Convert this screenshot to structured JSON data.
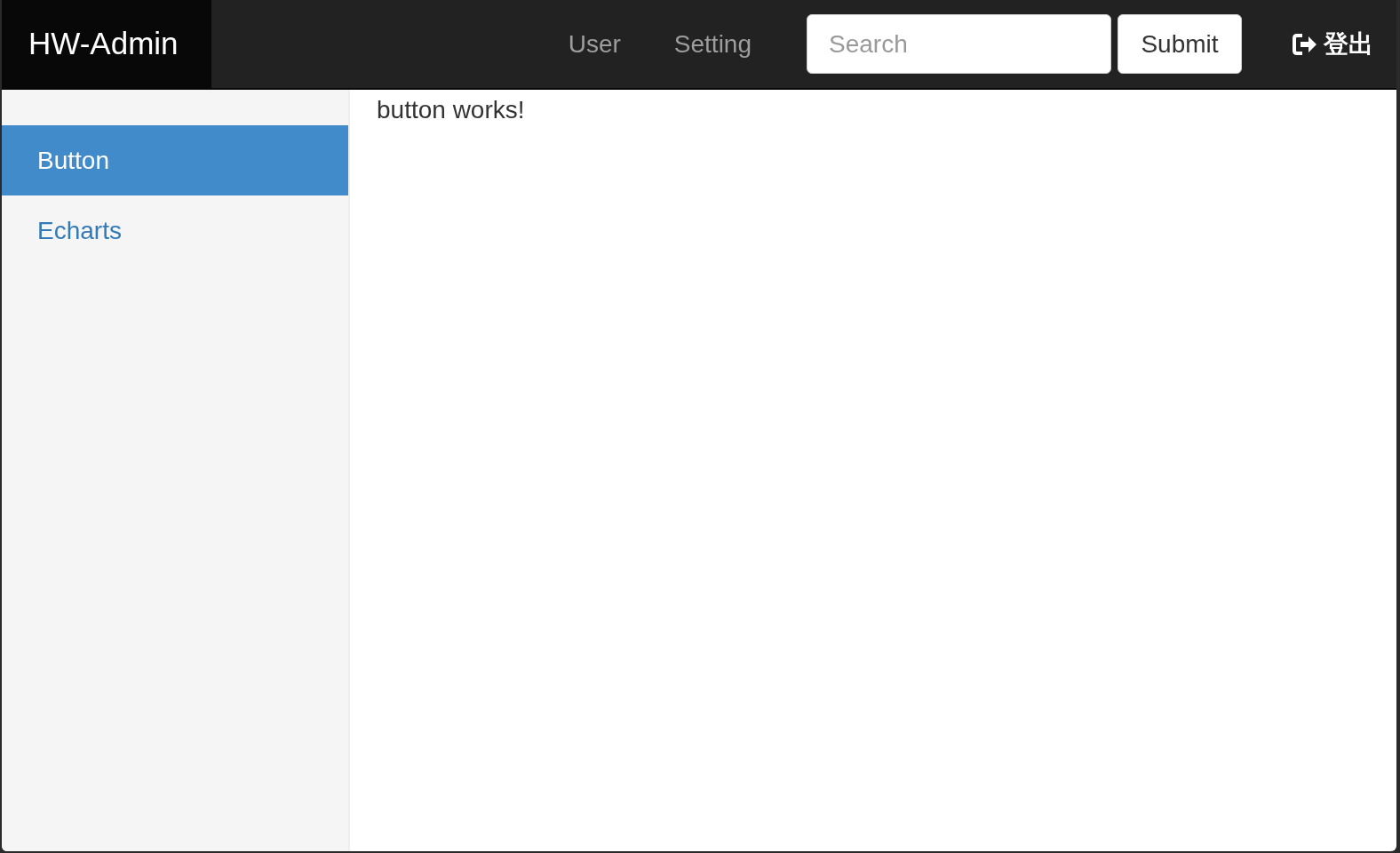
{
  "navbar": {
    "brand": "HW-Admin",
    "links": [
      {
        "label": "User"
      },
      {
        "label": "Setting"
      }
    ],
    "search": {
      "placeholder": "Search"
    },
    "submit": "Submit",
    "logout": "登出"
  },
  "sidebar": {
    "items": [
      {
        "label": "Button",
        "selected": true
      },
      {
        "label": "Echarts",
        "selected": false
      }
    ]
  },
  "content": {
    "text": "button works!"
  }
}
